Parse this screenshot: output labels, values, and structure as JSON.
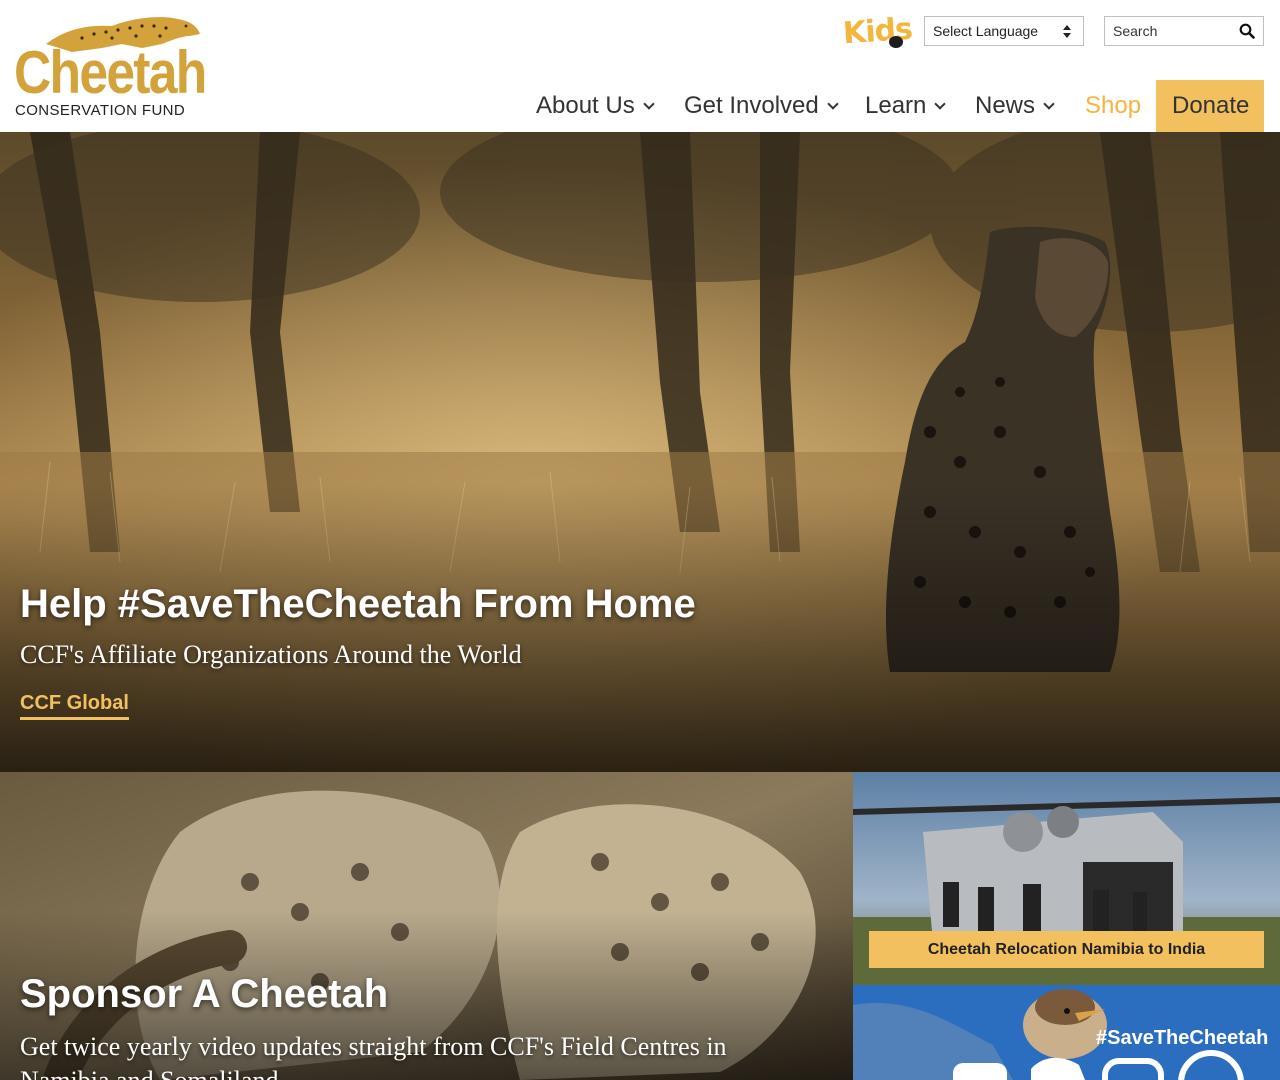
{
  "header": {
    "logo": {
      "word": "Cheetah",
      "subtitle": "CONSERVATION FUND"
    },
    "kids_link": "Kids",
    "language_select": "Select Language",
    "search": {
      "placeholder": "Search"
    },
    "nav": [
      {
        "label": "About Us",
        "dropdown": true
      },
      {
        "label": "Get Involved",
        "dropdown": true
      },
      {
        "label": "Learn",
        "dropdown": true
      },
      {
        "label": "News",
        "dropdown": true
      },
      {
        "label": "Shop",
        "dropdown": false
      },
      {
        "label": "Donate",
        "dropdown": false
      }
    ]
  },
  "hero": {
    "title": "Help #SaveTheCheetah From Home",
    "subtitle": "CCF's Affiliate Organizations Around the World",
    "link": "CCF Global"
  },
  "sponsor": {
    "title": "Sponsor A Cheetah",
    "text": "Get twice yearly video updates straight from CCF's Field Centres in Namibia and Somaliland"
  },
  "cards": {
    "relocation_label": "Cheetah Relocation Namibia to India",
    "social_tag": "#SaveTheCheetah"
  },
  "colors": {
    "brand_gold": "#d4a23a",
    "accent_yellow": "#f3c060",
    "shop_orange": "#f3b53c",
    "nav_text": "#333333"
  },
  "icons": [
    "search-icon",
    "chevron-down-icon",
    "cheetah-logo-icon",
    "paw-icon",
    "facebook-icon",
    "twitter-icon",
    "instagram-icon"
  ]
}
